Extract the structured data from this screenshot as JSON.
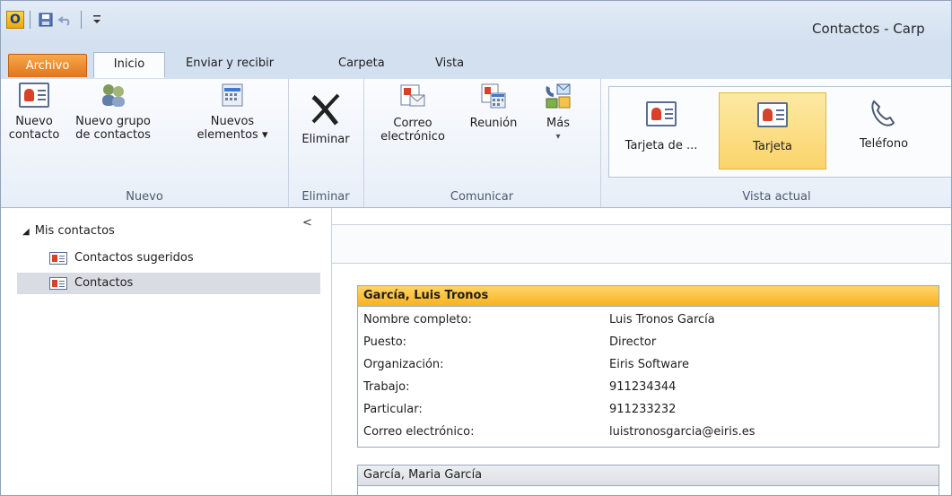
{
  "window": {
    "title": "Contactos - Carp"
  },
  "qat": {
    "app_icon": "O",
    "save_icon": "save-icon",
    "undo_icon": "undo-icon",
    "customize_icon": "customize-qat-icon"
  },
  "tabs": [
    {
      "label": "Archivo"
    },
    {
      "label": "Inicio"
    },
    {
      "label": "Enviar y recibir"
    },
    {
      "label": "Carpeta"
    },
    {
      "label": "Vista"
    }
  ],
  "ribbon": {
    "nuevo": {
      "label": "Nuevo",
      "new_contact": {
        "line1": "Nuevo",
        "line2": "contacto"
      },
      "new_group": {
        "line1": "Nuevo grupo",
        "line2": "de contactos"
      },
      "new_items": {
        "line1": "Nuevos",
        "line2": "elementos ▾"
      }
    },
    "eliminar": {
      "label": "Eliminar",
      "delete": {
        "line1": "Eliminar"
      }
    },
    "comunicar": {
      "label": "Comunicar",
      "email": {
        "line1": "Correo",
        "line2": "electrónico"
      },
      "meeting": {
        "line1": "Reunión"
      },
      "more": {
        "line1": "Más",
        "line2": "▾"
      }
    },
    "vista": {
      "label": "Vista actual",
      "business_card": "Tarjeta de ...",
      "card": "Tarjeta",
      "phone": "Teléfono"
    }
  },
  "nav": {
    "header": "Mis contactos",
    "items": [
      {
        "label": "Contactos sugeridos"
      },
      {
        "label": "Contactos"
      }
    ],
    "collapse": "<"
  },
  "contacts": [
    {
      "name": "García, Luis Tronos",
      "fields": [
        {
          "k": "Nombre completo:",
          "v": "Luis Tronos García"
        },
        {
          "k": "Puesto:",
          "v": "Director"
        },
        {
          "k": "Organización:",
          "v": "Eiris Software"
        },
        {
          "k": "Trabajo:",
          "v": "911234344"
        },
        {
          "k": "Particular:",
          "v": "911233232"
        },
        {
          "k": "Correo electrónico:",
          "v": "luistronosgarcia@eiris.es"
        }
      ]
    },
    {
      "name": "García, Maria García"
    }
  ],
  "colors": {
    "accent": "#f7b21f",
    "file_tab": "#e2751c",
    "ribbon_bg": "#d3e0f0"
  }
}
